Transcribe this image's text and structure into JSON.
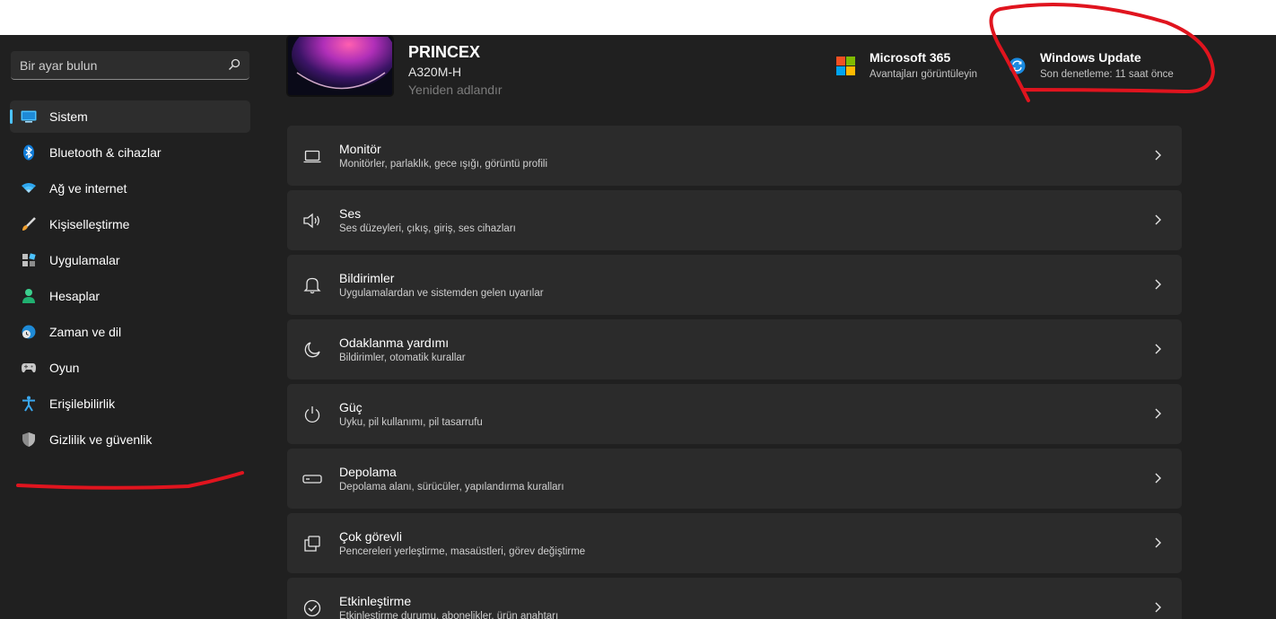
{
  "search": {
    "placeholder": "Bir ayar bulun"
  },
  "sidebar": {
    "items": [
      {
        "label": "Sistem",
        "icon": "monitor-icon",
        "selected": true
      },
      {
        "label": "Bluetooth & cihazlar",
        "icon": "bluetooth-icon"
      },
      {
        "label": "Ağ ve internet",
        "icon": "wifi-icon"
      },
      {
        "label": "Kişiselleştirme",
        "icon": "brush-icon"
      },
      {
        "label": "Uygulamalar",
        "icon": "apps-icon"
      },
      {
        "label": "Hesaplar",
        "icon": "person-icon"
      },
      {
        "label": "Zaman ve dil",
        "icon": "globe-clock-icon"
      },
      {
        "label": "Oyun",
        "icon": "gamepad-icon"
      },
      {
        "label": "Erişilebilirlik",
        "icon": "accessibility-icon"
      },
      {
        "label": "Gizlilik ve güvenlik",
        "icon": "shield-icon"
      }
    ]
  },
  "device": {
    "name": "PRINCEX",
    "model": "A320M-H",
    "rename": "Yeniden adlandır"
  },
  "header_cards": {
    "m365": {
      "title": "Microsoft 365",
      "subtitle": "Avantajları görüntüleyin"
    },
    "update": {
      "title": "Windows Update",
      "subtitle": "Son denetleme: 11 saat önce"
    }
  },
  "settings": [
    {
      "title": "Monitör",
      "subtitle": "Monitörler, parlaklık, gece ışığı, görüntü profili",
      "icon": "display-icon"
    },
    {
      "title": "Ses",
      "subtitle": "Ses düzeyleri, çıkış, giriş, ses cihazları",
      "icon": "speaker-icon"
    },
    {
      "title": "Bildirimler",
      "subtitle": "Uygulamalardan ve sistemden gelen uyarılar",
      "icon": "bell-icon"
    },
    {
      "title": "Odaklanma yardımı",
      "subtitle": "Bildirimler, otomatik kurallar",
      "icon": "moon-icon"
    },
    {
      "title": "Güç",
      "subtitle": "Uyku, pil kullanımı, pil tasarrufu",
      "icon": "power-icon"
    },
    {
      "title": "Depolama",
      "subtitle": "Depolama alanı, sürücüler, yapılandırma kuralları",
      "icon": "drive-icon"
    },
    {
      "title": "Çok görevli",
      "subtitle": "Pencereleri yerleştirme, masaüstleri, görev değiştirme",
      "icon": "multitask-icon"
    },
    {
      "title": "Etkinleştirme",
      "subtitle": "Etkinleştirme durumu, abonelikler, ürün anahtarı",
      "icon": "check-circle-icon"
    }
  ],
  "colors": {
    "accent": "#4cc2ff",
    "annotation": "#e0141e",
    "background": "#202020",
    "card": "#2b2b2b"
  }
}
